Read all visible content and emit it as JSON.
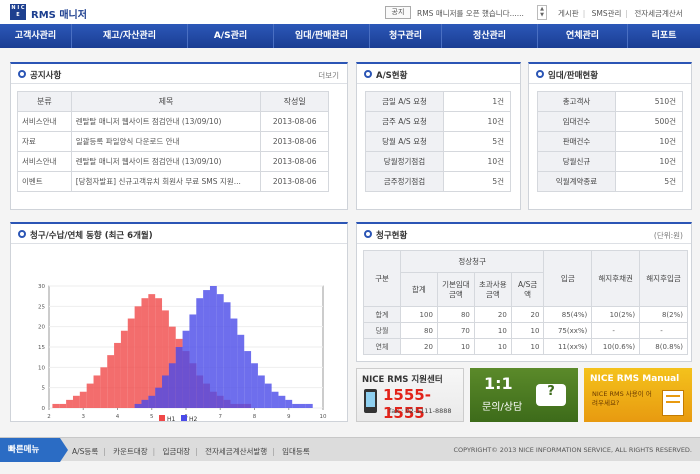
{
  "header": {
    "logo_text": "N I C E",
    "app_title": "RMS 매니저",
    "notice_tag": "공지",
    "notice_text": "RMS 매니저를 오픈 했습니다......",
    "top_links": [
      "게시판",
      "SMS관리",
      "전자세금계산서"
    ]
  },
  "nav": [
    "고객사관리",
    "재고/자산관리",
    "A/S관리",
    "임대/판매관리",
    "청구관리",
    "정산관리",
    "연체관리",
    "리포트"
  ],
  "notice": {
    "title": "공지사항",
    "more": "더보기",
    "columns": [
      "분류",
      "제목",
      "작성일"
    ],
    "rows": [
      {
        "cat": "서비스안내",
        "title": "렌탈탈 매니저 웹사이트 점검안내 (13/09/10)",
        "date": "2013-08-06"
      },
      {
        "cat": "자료",
        "title": "일괄등록 파일양식 다운로드 안내",
        "date": "2013-08-06"
      },
      {
        "cat": "서비스안내",
        "title": "렌탈탈 매니저 웹사이트 점검안내 (13/09/10)",
        "date": "2013-08-06"
      },
      {
        "cat": "이벤트",
        "title": "[당첨자발표] 신규고객유치 회원사 무료 SMS 지원...",
        "date": "2013-08-06"
      }
    ]
  },
  "as_status": {
    "title": "A/S현황",
    "rows": [
      {
        "label": "금일 A/S 요청",
        "value": "1건"
      },
      {
        "label": "금주 A/S 요청",
        "value": "10건"
      },
      {
        "label": "당월 A/S 요청",
        "value": "5건"
      },
      {
        "label": "당월정기점검",
        "value": "10건"
      },
      {
        "label": "금주정기점검",
        "value": "5건"
      }
    ]
  },
  "rental_status": {
    "title": "임대/판매현황",
    "rows": [
      {
        "label": "총고객사",
        "value": "510건"
      },
      {
        "label": "임대건수",
        "value": "500건"
      },
      {
        "label": "판매건수",
        "value": "10건"
      },
      {
        "label": "당월신규",
        "value": "10건"
      },
      {
        "label": "익월계약종료",
        "value": "5건"
      }
    ]
  },
  "chart_panel": {
    "title": "청구/수납/연체 동향 (최근 6개월)"
  },
  "chart_data": {
    "type": "bar",
    "title": "",
    "x_ticks": [
      2,
      3,
      4,
      5,
      6,
      7,
      8,
      9,
      10
    ],
    "y_ticks": [
      0,
      5,
      10,
      15,
      20,
      25,
      30
    ],
    "xlim": [
      2,
      10
    ],
    "ylim": [
      0,
      30
    ],
    "legend_position": "bottom",
    "series": [
      {
        "name": "H1",
        "color": "#f04848",
        "x": [
          2.2,
          2.4,
          2.6,
          2.8,
          3.0,
          3.2,
          3.4,
          3.6,
          3.8,
          4.0,
          4.2,
          4.4,
          4.6,
          4.8,
          5.0,
          5.2,
          5.4,
          5.6,
          5.8,
          6.0,
          6.2,
          6.4,
          6.6,
          6.8,
          7.0,
          7.2,
          7.4,
          7.6,
          7.8,
          8.0
        ],
        "values": [
          1,
          1,
          2,
          3,
          4,
          6,
          8,
          10,
          13,
          16,
          19,
          22,
          25,
          27,
          28,
          27,
          24,
          20,
          17,
          14,
          11,
          8,
          6,
          4,
          3,
          2,
          1,
          1,
          1,
          0
        ]
      },
      {
        "name": "H2",
        "color": "#4a4ae8",
        "x": [
          4.6,
          4.8,
          5.0,
          5.2,
          5.4,
          5.6,
          5.8,
          6.0,
          6.2,
          6.4,
          6.6,
          6.8,
          7.0,
          7.2,
          7.4,
          7.6,
          7.8,
          8.0,
          8.2,
          8.4,
          8.6,
          8.8,
          9.0,
          9.2,
          9.4,
          9.6
        ],
        "values": [
          1,
          2,
          3,
          5,
          8,
          11,
          15,
          19,
          23,
          27,
          29,
          30,
          28,
          26,
          22,
          18,
          14,
          11,
          8,
          6,
          4,
          3,
          2,
          1,
          1,
          1
        ]
      }
    ]
  },
  "billing": {
    "title": "청구현황",
    "unit": "(단위:원)",
    "head": {
      "category": "구분",
      "normal": "정상청구",
      "sum": "합계",
      "base": "기본임대금액",
      "excess": "초과사용금액",
      "as": "A/S금액",
      "receipt": "입금",
      "cancel_bond": "해지후채권",
      "cancel_receipt": "해지후입금"
    },
    "rows": [
      {
        "label": "합계",
        "sum": "100",
        "base": "80",
        "excess": "20",
        "as": "20",
        "receipt": "85(4%)",
        "cb": "10(2%)",
        "cr": "8(2%)"
      },
      {
        "label": "당월",
        "sum": "80",
        "base": "70",
        "excess": "10",
        "as": "10",
        "receipt": "75(xx%)",
        "cb": "-",
        "cr": "-"
      },
      {
        "label": "연체",
        "sum": "20",
        "base": "10",
        "excess": "10",
        "as": "10",
        "receipt": "11(xx%)",
        "cb": "10(0.6%)",
        "cr": "8(0.8%)"
      }
    ]
  },
  "banners": {
    "support_title": "NICE RMS 지원센터",
    "support_phone": "1555-1555",
    "support_fax": "fax : 02-1111-8888",
    "consult_title": "1:1",
    "consult_sub": "문의/상담",
    "manual_title": "NICE RMS Manual",
    "manual_sub": "NICE RMS 사용이 어려우세요?"
  },
  "footer": {
    "quick_label": "빠른메뉴",
    "links": [
      "A/S등록",
      "카운트대장",
      "입금대장",
      "전자세금계산서발행",
      "임대등록"
    ],
    "copyright": "COPYRIGHT© 2013  NICE INFORMATION SERVICE,  ALL RIGHTS RESERVED."
  }
}
